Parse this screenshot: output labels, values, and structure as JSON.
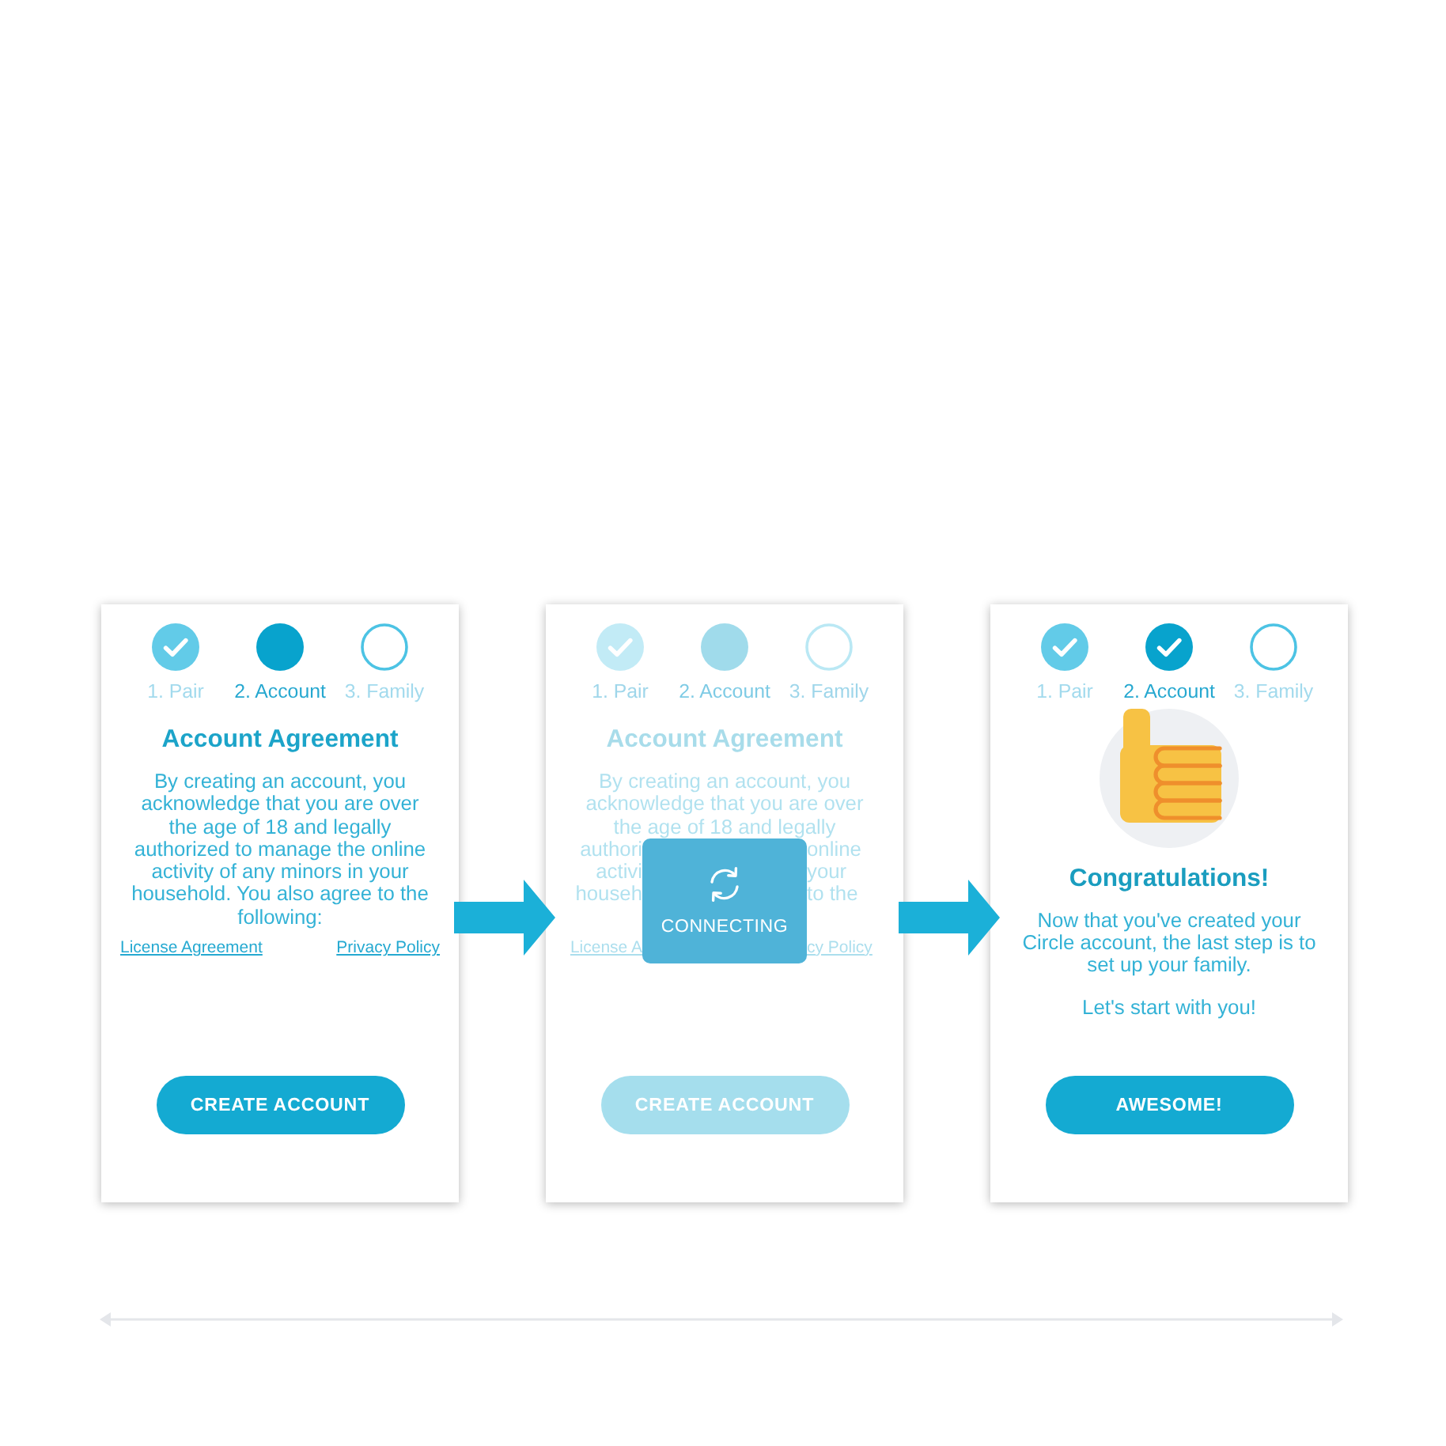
{
  "screens": [
    {
      "kind": "agreement",
      "faded": false,
      "steps": [
        {
          "label": "1. Pair",
          "selected": false,
          "checked": true
        },
        {
          "label": "2. Account",
          "selected": true,
          "checked": false
        },
        {
          "label": "3. Family",
          "selected": false,
          "checked": false
        }
      ],
      "title": "Account Agreement",
      "body": "By creating an account, you acknowledge that you are over the age of 18 and legally authorized to manage the online activity of any minors in your household. You also agree to the following:",
      "links": [
        "License Agreement",
        "Privacy Policy"
      ],
      "button": "CREATE ACCOUNT"
    },
    {
      "kind": "connecting",
      "faded": true,
      "steps": [
        {
          "label": "1. Pair",
          "selected": false,
          "checked": true
        },
        {
          "label": "2. Account",
          "selected": true,
          "checked": false
        },
        {
          "label": "3. Family",
          "selected": false,
          "checked": false
        }
      ],
      "title": "Account Agreement",
      "body_lines": [
        [
          "By creating an account, you"
        ],
        [
          "acknowledge that you are over"
        ],
        [
          "the age of 18 and legally"
        ],
        [
          "authori",
          "online"
        ],
        [
          "activi",
          "your"
        ],
        [
          "househ",
          "to the"
        ]
      ],
      "links": [
        "License A",
        "cy Policy"
      ],
      "overlay": {
        "label": "CONNECTING"
      },
      "button": "CREATE ACCOUNT"
    },
    {
      "kind": "success",
      "faded": false,
      "steps": [
        {
          "label": "1. Pair",
          "selected": false,
          "checked": true
        },
        {
          "label": "2. Account",
          "selected": true,
          "checked": true
        },
        {
          "label": "3. Family",
          "selected": false,
          "checked": false
        }
      ],
      "title": "Congratulations!",
      "body": "Now that you've created your Circle account, the last step is to set up your family.",
      "note": "Let's start with you!",
      "button": "AWESOME!"
    }
  ]
}
